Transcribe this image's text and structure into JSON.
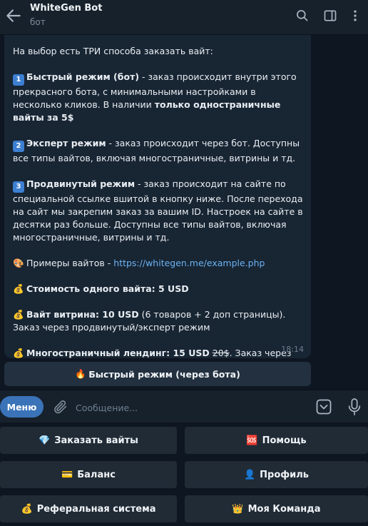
{
  "header": {
    "title": "WhiteGen Bot",
    "subtitle": "бот"
  },
  "message": {
    "intro": "На выбор есть ТРИ способа заказать вайт:",
    "opt1_num": "1",
    "opt1_title": "Быстрый режим (бот)",
    "opt1_text": " - заказ происходит внутри этого прекрасного бота, с минимальными настройками в несколько кликов. В наличии ",
    "opt1_bold": "только одностраничные вайты за 5$",
    "opt2_num": "2",
    "opt2_title": "Эксперт режим",
    "opt2_text": " - заказ происходит через бот. Доступны все типы вайтов, включая многостраничные, витрины и тд.",
    "opt3_num": "3",
    "opt3_title": "Продвинутый режим",
    "opt3_text": " - заказ происходит на сайте по специальной ссылке вшитой в кнопку ниже. После перехода на сайт мы закрепим заказ за вашим ID. Настроек на сайте в десятки раз больше. Доступны все типы вайтов, включая многостраничные, витрины и тд.",
    "examples_label": "Примеры вайтов - ",
    "examples_link": "https://whitegen.me/example.php",
    "price_one": "Стоимость одного вайта: 5 USD",
    "showcase_bold": "Вайт витрина: 10 USD",
    "showcase_text": " (6 товаров + 2 доп страницы). Заказ через продвинутый/эксперт режим",
    "landing_bold": "Многостраничный лендинг: 15 USD",
    "landing_old": "20$",
    "landing_text": ". Заказ через продвинутый/эксперт режим",
    "time": "18:14"
  },
  "inline_button": {
    "label": "Быстрый режим (через бота)"
  },
  "composer": {
    "menu_label": "Меню",
    "placeholder": "Сообщение..."
  },
  "keyboard": {
    "order": "Заказать вайты",
    "help": "Помощь",
    "balance": "Баланс",
    "profile": "Профиль",
    "referral": "Реферальная система",
    "team": "Моя Команда"
  },
  "icons": {
    "back": "arrow-left-icon",
    "search": "search-icon",
    "sidebar": "sidebar-icon",
    "more": "more-vertical-icon",
    "clip": "paperclip-icon",
    "keyboard_toggle": "keyboard-toggle-icon",
    "mic": "microphone-icon"
  },
  "colors": {
    "accent": "#3a73b8",
    "link": "#6ab2f2",
    "bubble": "#182533",
    "background": "#0e1621"
  }
}
